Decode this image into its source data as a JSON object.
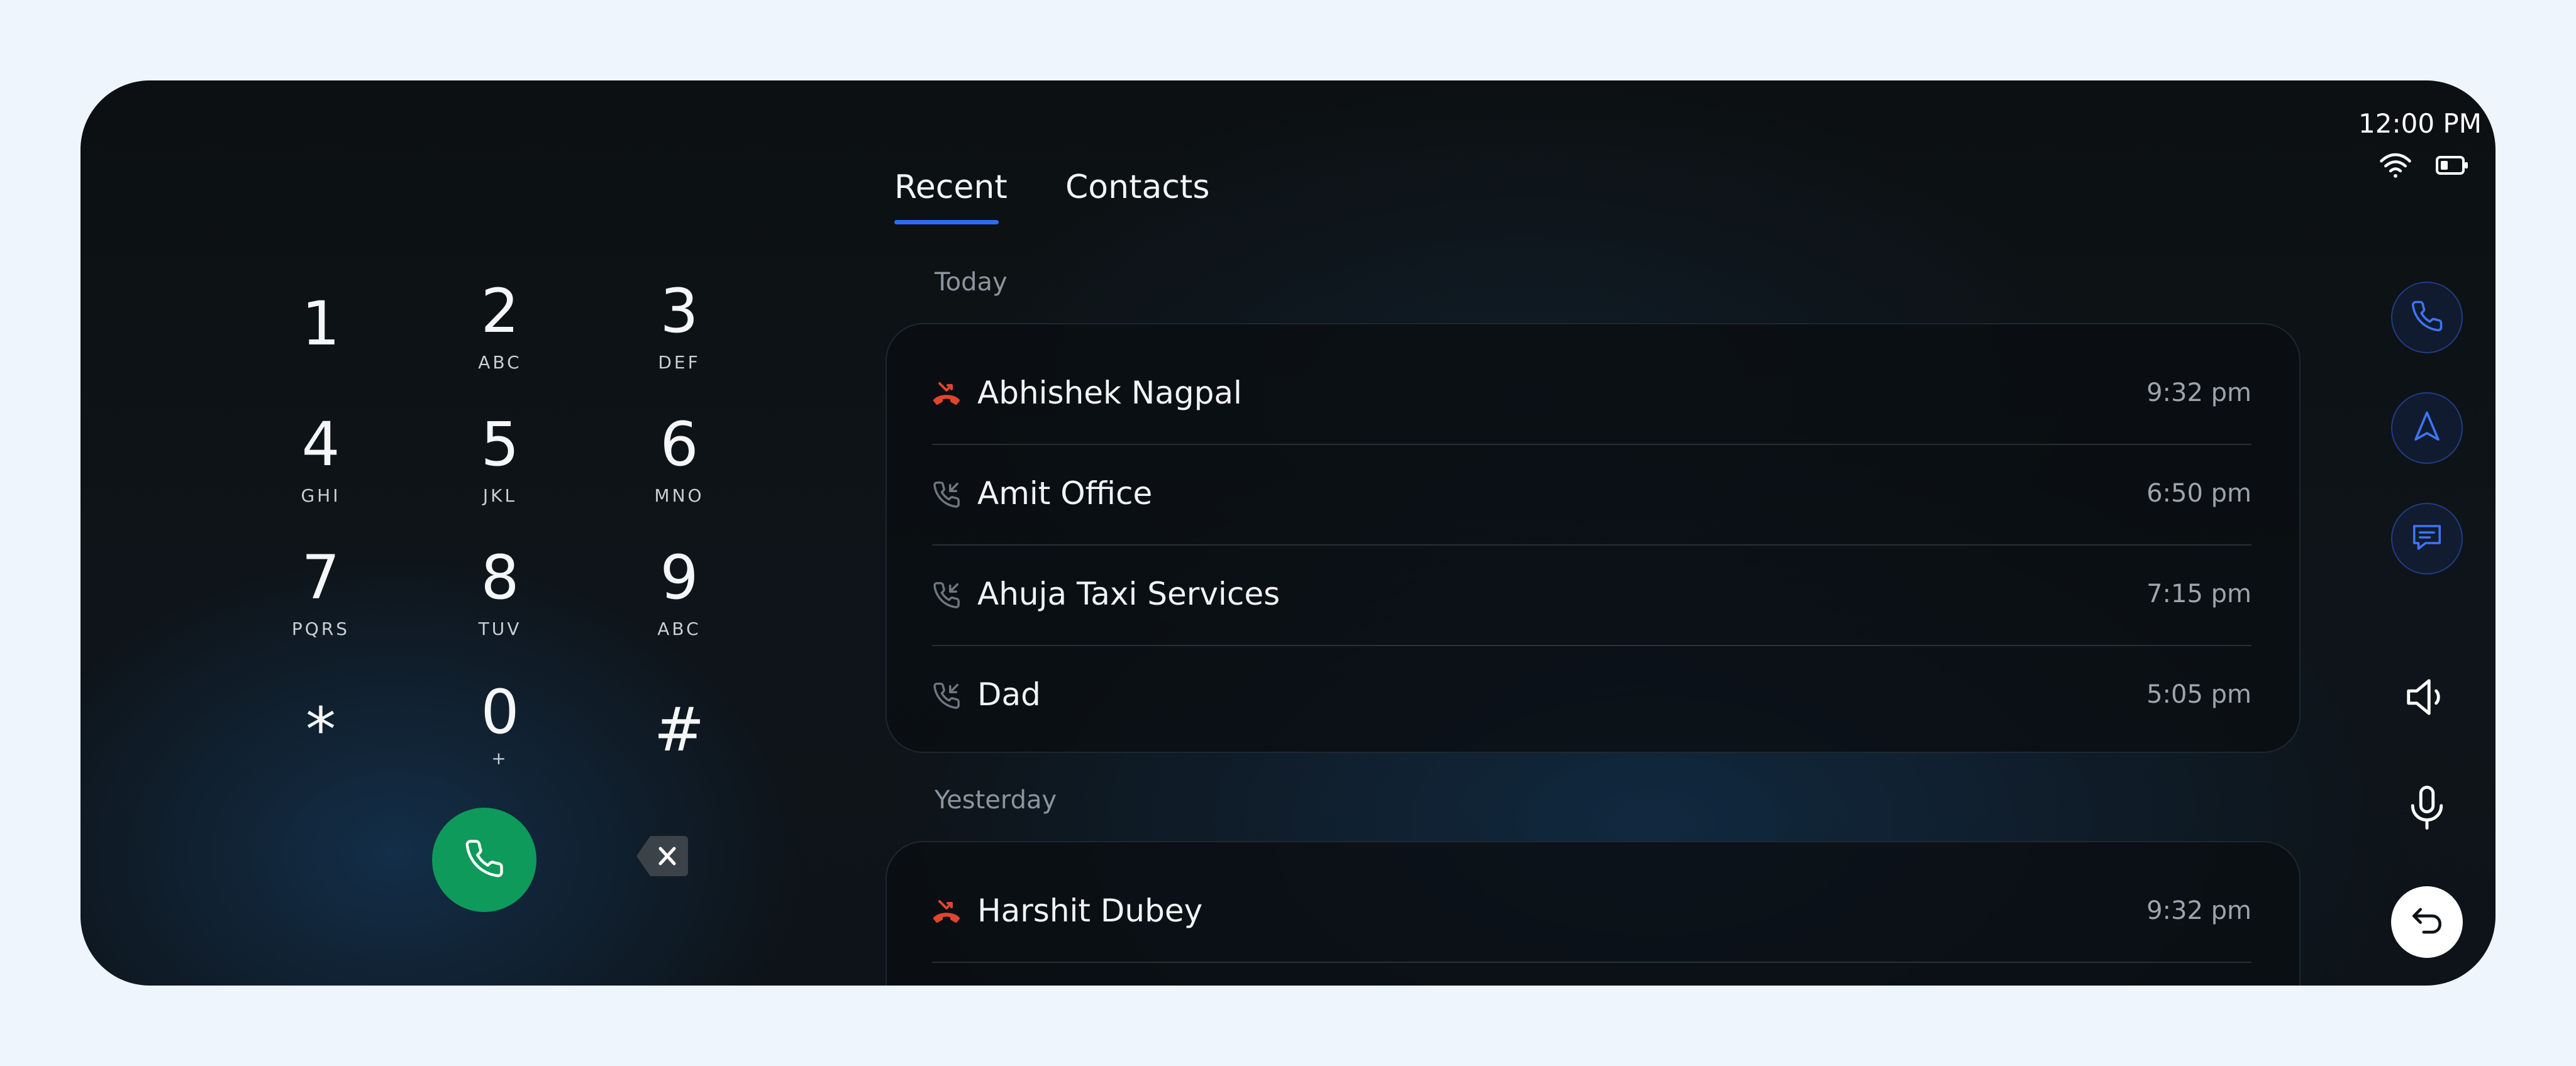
{
  "status_bar": {
    "time": "12:00 PM",
    "wifi_icon": "wifi-icon",
    "battery_icon": "battery-icon"
  },
  "dialpad": {
    "keys": [
      {
        "digit": "1",
        "letters": ""
      },
      {
        "digit": "2",
        "letters": "ABC"
      },
      {
        "digit": "3",
        "letters": "DEF"
      },
      {
        "digit": "4",
        "letters": "GHI"
      },
      {
        "digit": "5",
        "letters": "JKL"
      },
      {
        "digit": "6",
        "letters": "MNO"
      },
      {
        "digit": "7",
        "letters": "PQRS"
      },
      {
        "digit": "8",
        "letters": "TUV"
      },
      {
        "digit": "9",
        "letters": "ABC"
      },
      {
        "digit": "*",
        "letters": ""
      },
      {
        "digit": "0",
        "letters": "+"
      },
      {
        "digit": "#",
        "letters": ""
      }
    ],
    "call_button_icon": "phone-icon",
    "backspace_icon": "backspace-icon"
  },
  "tabs": [
    {
      "label": "Recent",
      "active": true
    },
    {
      "label": "Contacts",
      "active": false
    }
  ],
  "sections": [
    {
      "label": "Today",
      "calls": [
        {
          "name": "Abhishek Nagpal",
          "time": "9:32 pm",
          "type": "missed"
        },
        {
          "name": "Amit Office",
          "time": "6:50 pm",
          "type": "incoming"
        },
        {
          "name": "Ahuja Taxi Services",
          "time": "7:15 pm",
          "type": "incoming"
        },
        {
          "name": "Dad",
          "time": "5:05 pm",
          "type": "incoming"
        }
      ]
    },
    {
      "label": "Yesterday",
      "calls": [
        {
          "name": "Harshit Dubey",
          "time": "9:32 pm",
          "type": "missed"
        }
      ]
    }
  ],
  "rail": {
    "buttons": [
      "phone-icon",
      "navigation-icon",
      "message-icon",
      "speaker-icon",
      "microphone-icon",
      "back-icon"
    ]
  },
  "colors": {
    "accent": "#2F6BF2",
    "call_green": "#0E9A5A",
    "missed_red": "#E0452F",
    "background": "#EEF5FD"
  }
}
